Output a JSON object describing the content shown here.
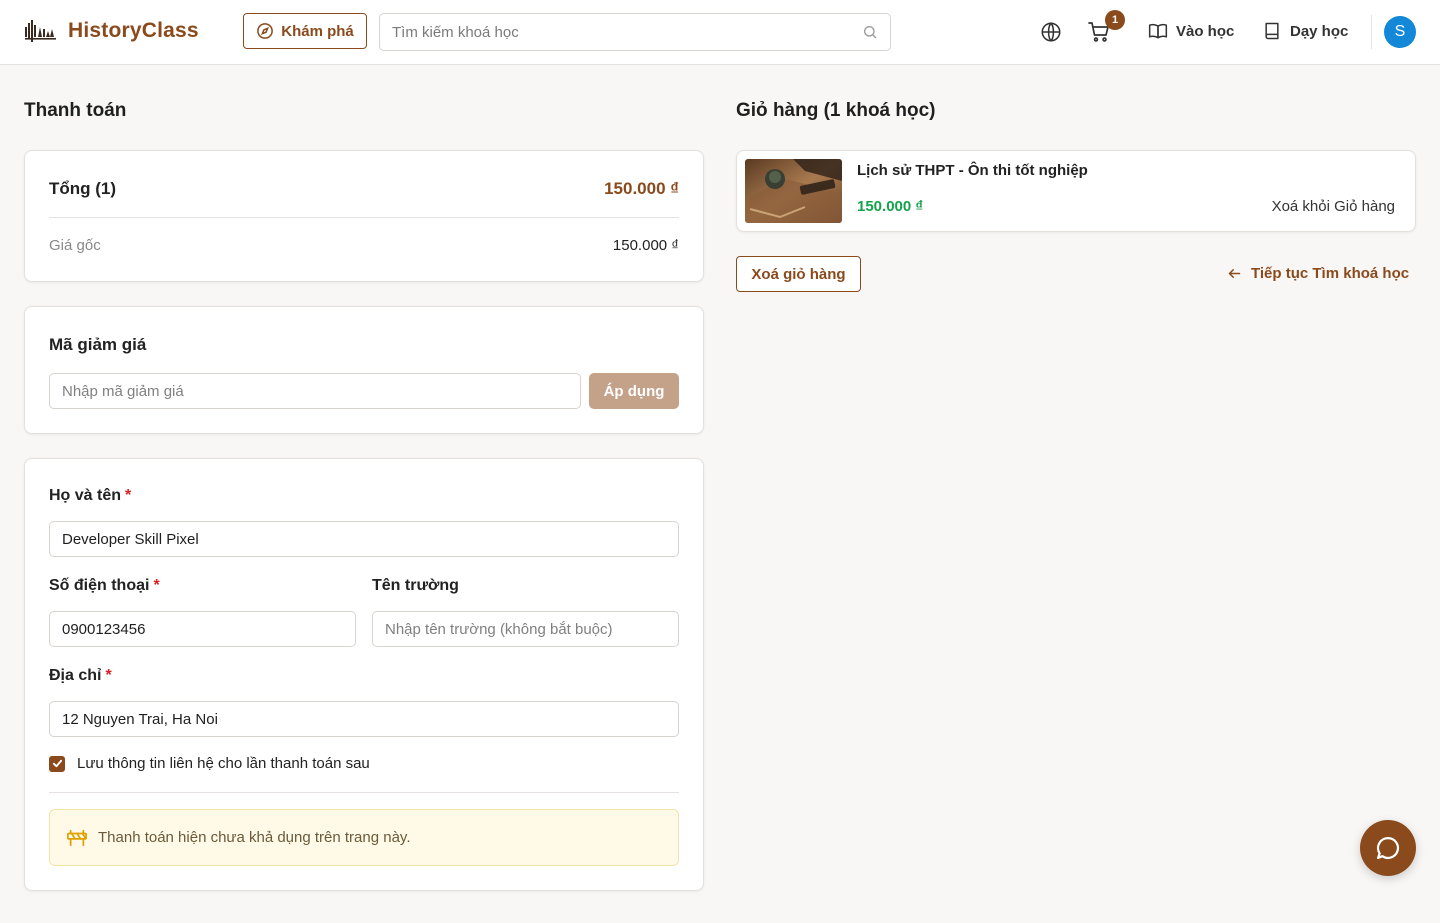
{
  "header": {
    "brand": "HistoryClass",
    "explore_label": "Khám phá",
    "search_placeholder": "Tìm kiếm khoá học",
    "cart_count": "1",
    "learn_label": "Vào học",
    "teach_label": "Dạy học",
    "avatar_initial": "S"
  },
  "checkout": {
    "title": "Thanh toán",
    "summary": {
      "total_label": "Tổng (1)",
      "total_value": "150.000 ₫",
      "original_label": "Giá gốc",
      "original_value": "150.000 ₫"
    },
    "coupon": {
      "title": "Mã giảm giá",
      "placeholder": "Nhập mã giảm giá",
      "apply_label": "Áp dụng"
    },
    "form": {
      "name_label": "Họ và tên",
      "name_value": "Developer Skill Pixel",
      "phone_label": "Số điện thoại",
      "phone_value": "0900123456",
      "school_label": "Tên trường",
      "school_placeholder": "Nhập tên trường (không bắt buộc)",
      "address_label": "Địa chỉ",
      "address_value": "12 Nguyen Trai, Ha Noi",
      "required_mark": "*",
      "save_info_label": "Lưu thông tin liên hệ cho lần thanh toán sau",
      "save_info_checked": true,
      "notice": "Thanh toán hiện chưa khả dụng trên trang này."
    }
  },
  "cart": {
    "title": "Giỏ hàng (1 khoá học)",
    "items": [
      {
        "title": "Lịch sử THPT - Ôn thi tốt nghiệp",
        "price": "150.000 ₫",
        "remove_label": "Xoá khỏi Giỏ hàng"
      }
    ],
    "clear_label": "Xoá giỏ hàng",
    "continue_label": "Tiếp tục Tìm khoá học"
  },
  "colors": {
    "brand": "#8a4a1c",
    "price_green": "#15a34a",
    "required_red": "#d81f26",
    "avatar_blue": "#1288d6"
  },
  "icons": [
    "logo-icon",
    "compass-icon",
    "search-icon",
    "globe-icon",
    "cart-icon",
    "book-open-icon",
    "book-icon",
    "check-icon",
    "construction-icon",
    "arrow-left-icon",
    "chat-icon"
  ]
}
